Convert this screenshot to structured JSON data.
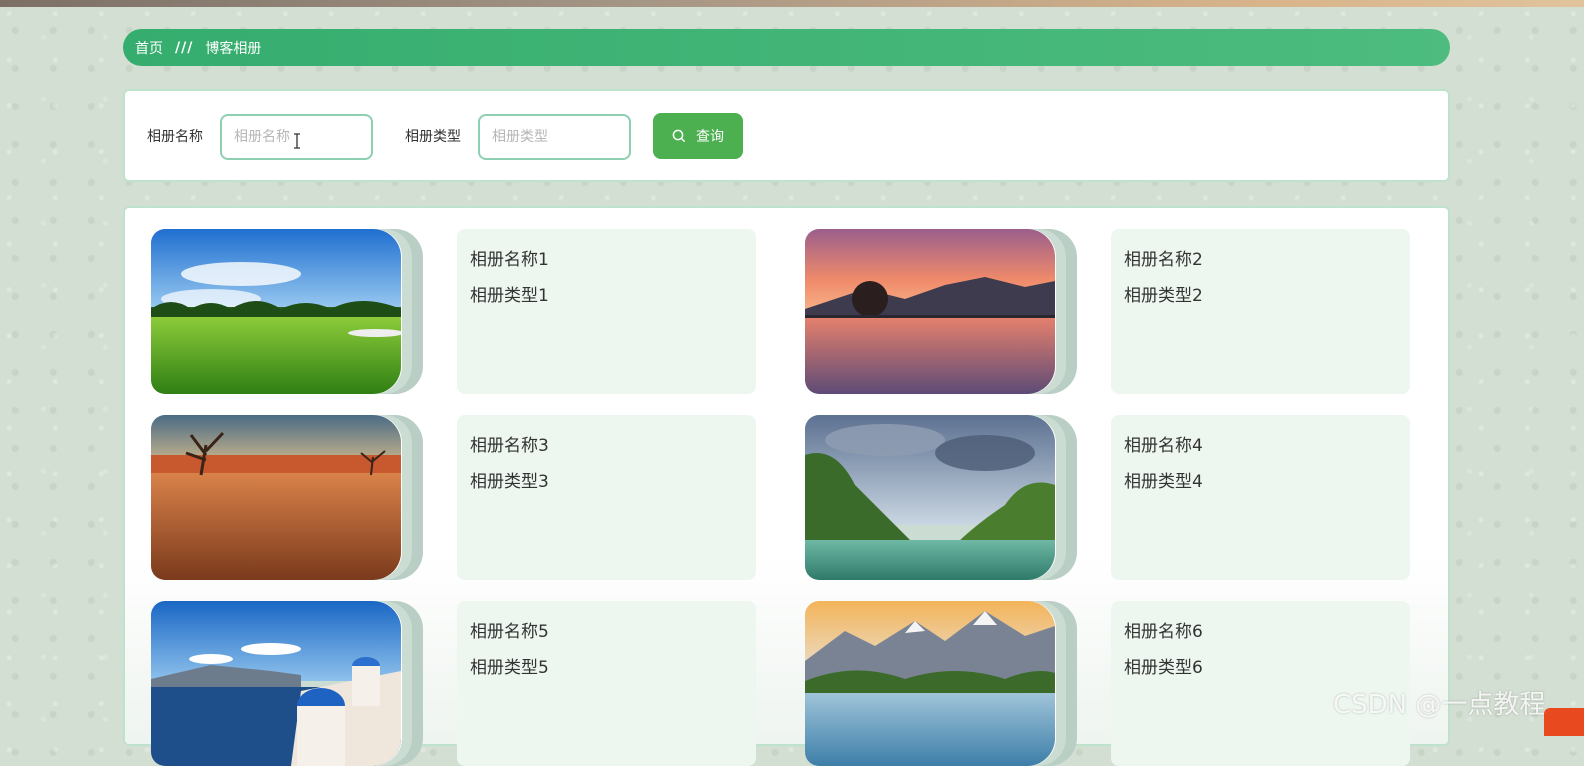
{
  "breadcrumb": {
    "home": "首页",
    "separator": "///",
    "current": "博客相册"
  },
  "search": {
    "name_label": "相册名称",
    "name_placeholder": "相册名称",
    "type_label": "相册类型",
    "type_placeholder": "相册类型",
    "button_label": "查询"
  },
  "albums": [
    {
      "name": "相册名称1",
      "type": "相册类型1"
    },
    {
      "name": "相册名称2",
      "type": "相册类型2"
    },
    {
      "name": "相册名称3",
      "type": "相册类型3"
    },
    {
      "name": "相册名称4",
      "type": "相册类型4"
    },
    {
      "name": "相册名称5",
      "type": "相册类型5"
    },
    {
      "name": "相册名称6",
      "type": "相册类型6"
    }
  ],
  "watermark": "CSDN @一点教程",
  "colors": {
    "accent": "#4caf50",
    "breadcrumb": "#3db574",
    "border": "#bfe2cd",
    "info_bg": "#edf6ef"
  }
}
